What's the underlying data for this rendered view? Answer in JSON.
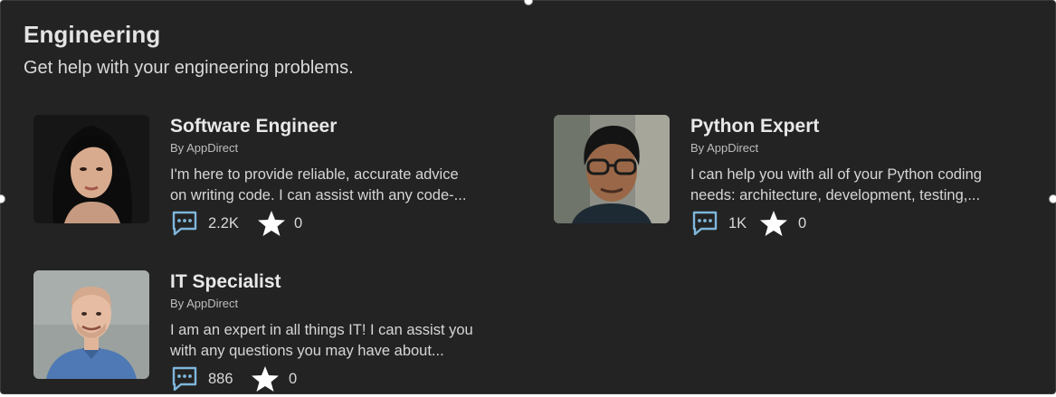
{
  "section": {
    "title": "Engineering",
    "subtitle": "Get help with your engineering problems."
  },
  "colors": {
    "background": "#232323",
    "chat_icon": "#7fb6dc",
    "star_icon": "#ffffff"
  },
  "cards": [
    {
      "title": "Software Engineer",
      "author": "By AppDirect",
      "description_line1": "I'm here to provide reliable, accurate advice",
      "description_line2": "on writing code. I can assist with any code-...",
      "chats": "2.2K",
      "stars": "0",
      "chat_icon": "chat-bubble-icon",
      "star_icon": "star-icon"
    },
    {
      "title": "Python Expert",
      "author": "By AppDirect",
      "description_line1": "I can help you with all of your Python coding",
      "description_line2": "needs: architecture, development, testing,...",
      "chats": "1K",
      "stars": "0",
      "chat_icon": "chat-bubble-icon",
      "star_icon": "star-icon"
    },
    {
      "title": "IT Specialist",
      "author": "By AppDirect",
      "description_line1": "I am an expert in all things IT! I can assist you",
      "description_line2": "with any questions you may have about...",
      "chats": "886",
      "stars": "0",
      "chat_icon": "chat-bubble-icon",
      "star_icon": "star-icon"
    }
  ]
}
